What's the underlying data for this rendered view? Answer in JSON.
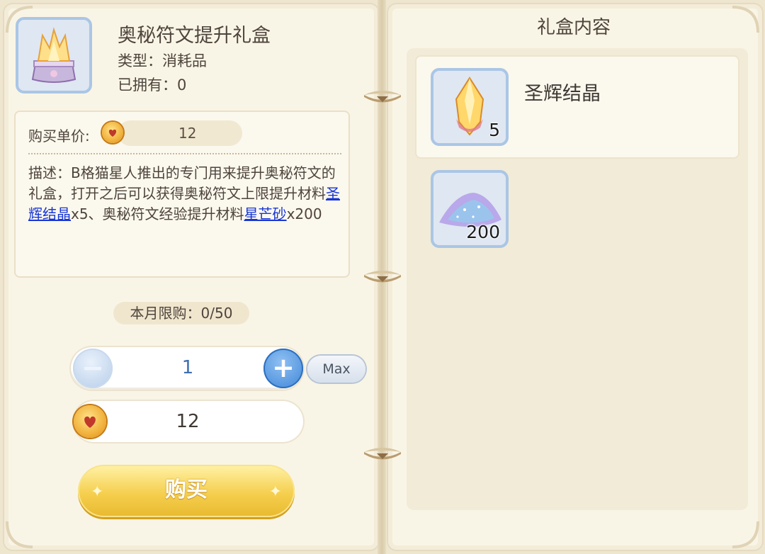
{
  "item": {
    "title": "奥秘符文提升礼盒",
    "type": "类型：消耗品",
    "owned": "已拥有：0",
    "price_label": "购买单价:",
    "price": "12",
    "description": {
      "prefix": "描述：B格猫星人推出的专门用来提升奥秘符文的礼盒，打开之后可以获得奥秘符文上限提升材料",
      "link1": "圣辉结晶",
      "mid": "x5、奥秘符文经验提升材料",
      "link2": "星芒砂",
      "suffix": "x200"
    }
  },
  "purchase": {
    "monthly_limit": "本月限购：0/50",
    "quantity": "1",
    "minus_symbol": "−",
    "plus_symbol": "+",
    "max_label": "Max",
    "total_cost": "12",
    "buy_label": "购买"
  },
  "contents": {
    "title": "礼盒内容",
    "items": [
      {
        "name": "圣辉结晶",
        "count": "5",
        "icon": "crystal-icon"
      },
      {
        "name": "",
        "count": "200",
        "icon": "star-sand-icon"
      }
    ]
  },
  "colors": {
    "page_bg": "#f9f5e6",
    "link": "#1736d6",
    "frame_blue": "#aac6e6",
    "buy_gold": "#f5cf4e"
  }
}
